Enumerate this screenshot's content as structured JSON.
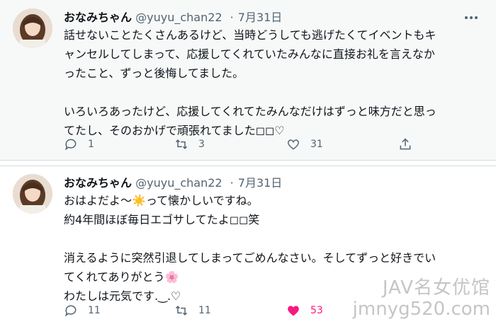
{
  "tweets": [
    {
      "name": "おなみちゃん",
      "handle": "@yuyu_chan22",
      "separator": "·",
      "date": "7月31日",
      "lines": [
        "話せないことたくさんあるけど、当時どうしても逃げたくてイベントもキ",
        "ャンセルしてしまって、応援してくれていたみんなに直接お礼を言えなか",
        "ったこと、ずっと後悔してました。",
        "",
        "いろいろあったけど、応援してくれてたみんなだけはずっと味方だと思っ",
        "てたし、そのおかげで頑張れてました◻︎◻︎♡"
      ],
      "replies": "1",
      "retweets": "3",
      "likes": "31",
      "liked": false
    },
    {
      "name": "おなみちゃん",
      "handle": "@yuyu_chan22",
      "separator": "·",
      "date": "7月31日",
      "lines": [
        "おはよだよ〜☀️って懐かしいですね。",
        "約4年間ほぼ毎日エゴサしてたよ◻︎◻︎笑",
        "",
        "消えるように突然引退してしまってごめんなさい。そしてずっと好きでい",
        "てくれてありがとう🌸",
        "わたしは元気です.‿.♡"
      ],
      "replies": "11",
      "retweets": "11",
      "likes": "53",
      "liked": true
    }
  ],
  "icons": {
    "reply": "speech-bubble-icon",
    "retweet": "retweet-arrows-icon",
    "like": "heart-icon",
    "share": "share-upload-icon",
    "more": "more-dots-icon"
  },
  "colors": {
    "like_active": "#f91880",
    "muted": "#536471",
    "text": "#0f1419"
  },
  "watermark": {
    "line1": "JAV名女优馆",
    "line2": "jmnyg520.com"
  }
}
